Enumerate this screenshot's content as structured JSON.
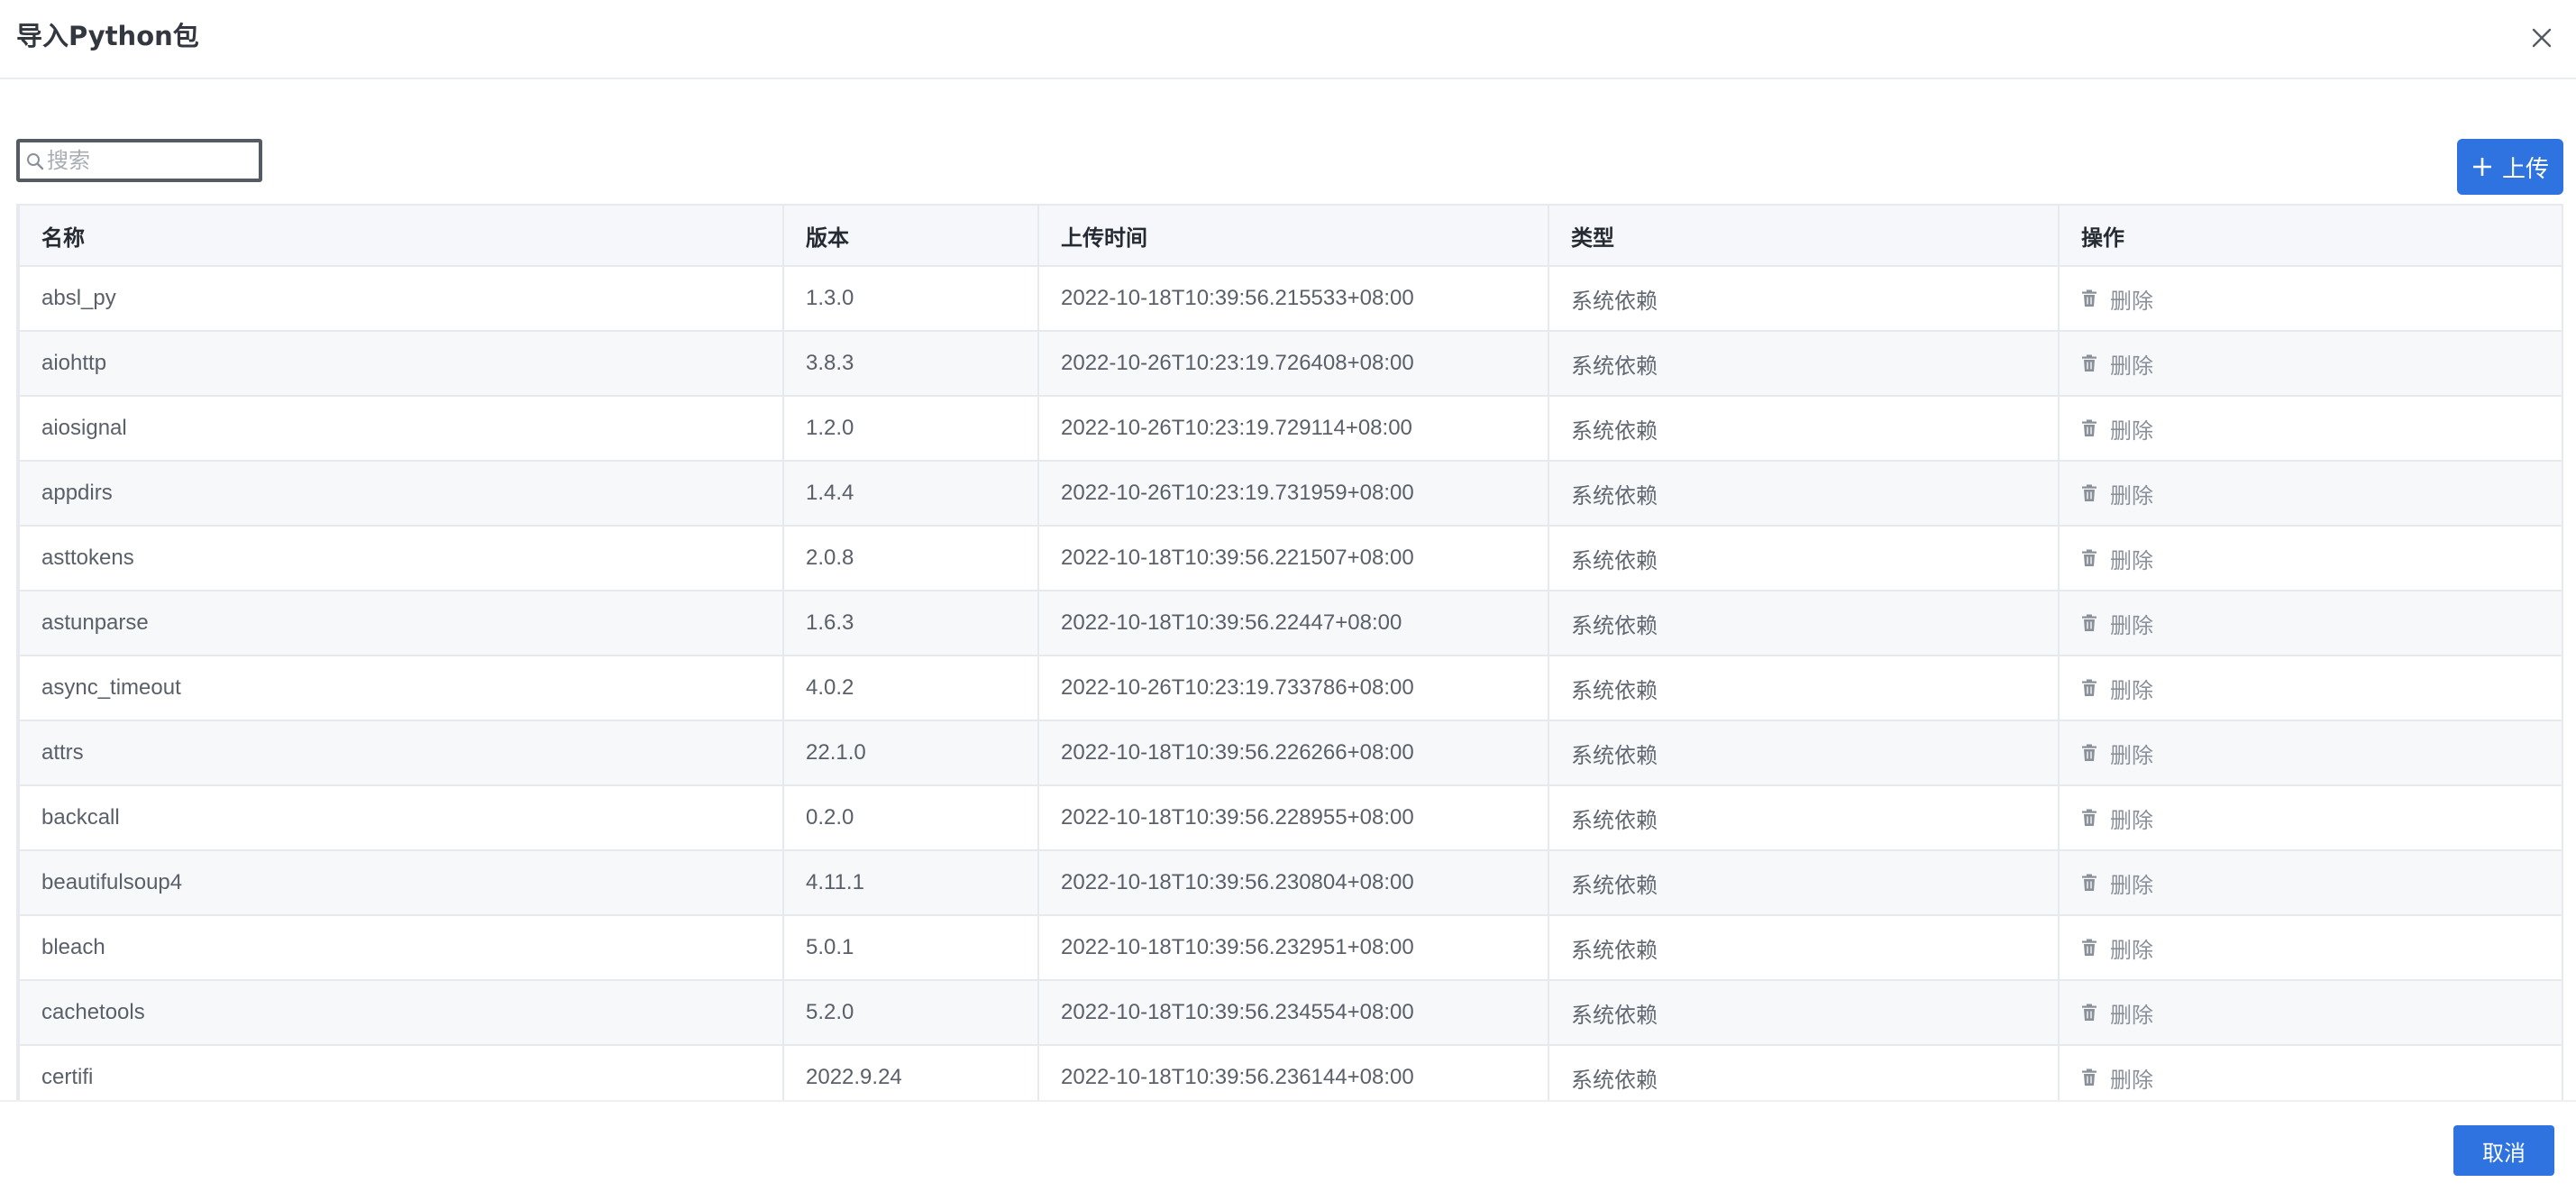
{
  "dialog": {
    "title": "导入Python包"
  },
  "search": {
    "placeholder": "搜索",
    "value": ""
  },
  "toolbar": {
    "upload_label": "上传"
  },
  "table": {
    "columns": [
      "名称",
      "版本",
      "上传时间",
      "类型",
      "操作"
    ],
    "rows": [
      {
        "name": "absl_py",
        "version": "1.3.0",
        "time": "2022-10-18T10:39:56.215533+08:00",
        "type": "系统依赖",
        "action": "删除"
      },
      {
        "name": "aiohttp",
        "version": "3.8.3",
        "time": "2022-10-26T10:23:19.726408+08:00",
        "type": "系统依赖",
        "action": "删除"
      },
      {
        "name": "aiosignal",
        "version": "1.2.0",
        "time": "2022-10-26T10:23:19.729114+08:00",
        "type": "系统依赖",
        "action": "删除"
      },
      {
        "name": "appdirs",
        "version": "1.4.4",
        "time": "2022-10-26T10:23:19.731959+08:00",
        "type": "系统依赖",
        "action": "删除"
      },
      {
        "name": "asttokens",
        "version": "2.0.8",
        "time": "2022-10-18T10:39:56.221507+08:00",
        "type": "系统依赖",
        "action": "删除"
      },
      {
        "name": "astunparse",
        "version": "1.6.3",
        "time": "2022-10-18T10:39:56.22447+08:00",
        "type": "系统依赖",
        "action": "删除"
      },
      {
        "name": "async_timeout",
        "version": "4.0.2",
        "time": "2022-10-26T10:23:19.733786+08:00",
        "type": "系统依赖",
        "action": "删除"
      },
      {
        "name": "attrs",
        "version": "22.1.0",
        "time": "2022-10-18T10:39:56.226266+08:00",
        "type": "系统依赖",
        "action": "删除"
      },
      {
        "name": "backcall",
        "version": "0.2.0",
        "time": "2022-10-18T10:39:56.228955+08:00",
        "type": "系统依赖",
        "action": "删除"
      },
      {
        "name": "beautifulsoup4",
        "version": "4.11.1",
        "time": "2022-10-18T10:39:56.230804+08:00",
        "type": "系统依赖",
        "action": "删除"
      },
      {
        "name": "bleach",
        "version": "5.0.1",
        "time": "2022-10-18T10:39:56.232951+08:00",
        "type": "系统依赖",
        "action": "删除"
      },
      {
        "name": "cachetools",
        "version": "5.2.0",
        "time": "2022-10-18T10:39:56.234554+08:00",
        "type": "系统依赖",
        "action": "删除"
      },
      {
        "name": "certifi",
        "version": "2022.9.24",
        "time": "2022-10-18T10:39:56.236144+08:00",
        "type": "系统依赖",
        "action": "删除"
      }
    ]
  },
  "footer": {
    "cancel_label": "取消"
  },
  "icons": {
    "close": "close-icon",
    "search": "search-icon",
    "upload": "plus-icon",
    "delete": "trash-icon"
  },
  "colors": {
    "primary": "#2f73e0",
    "header_bg": "#f5f7fa",
    "stripe_bg": "#f7f8fa",
    "border": "#e6e9ee"
  }
}
